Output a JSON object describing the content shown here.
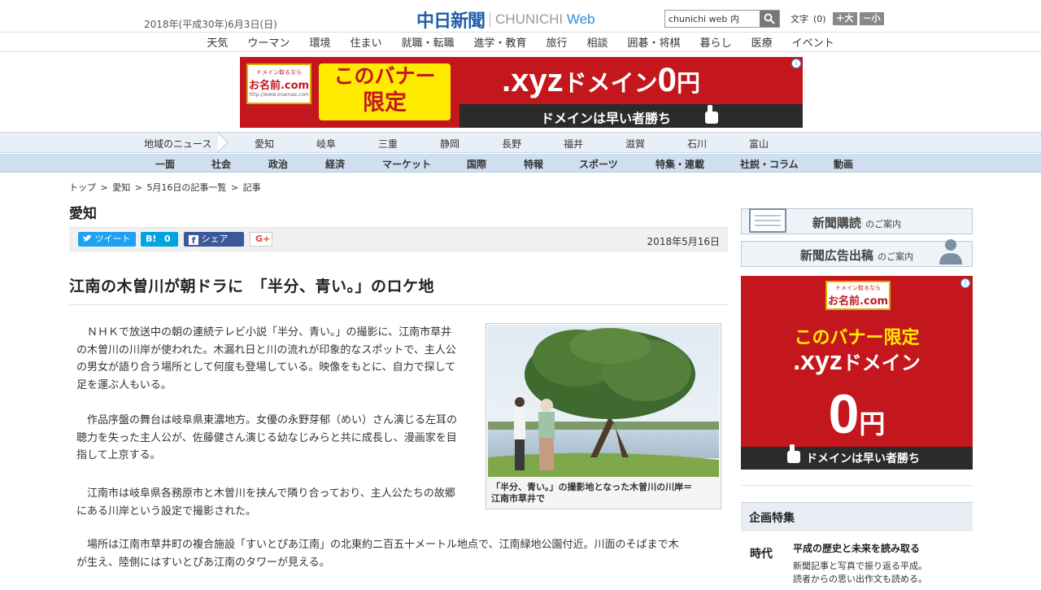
{
  "header": {
    "date": "2018年(平成30年)6月3日(日)",
    "logo_ja": "中日新聞",
    "logo_en_1": "CHUNICHI",
    "logo_en_2": "Web",
    "search_value": "chunichi web 内",
    "fontsize_label": "文字",
    "fontsize_value": "(0)",
    "font_up": "＋大",
    "font_down": "－小"
  },
  "categories": [
    "天気",
    "ウーマン",
    "環境",
    "住まい",
    "就職・転職",
    "進学・教育",
    "旅行",
    "相談",
    "囲碁・将棋",
    "暮らし",
    "医療",
    "イベント"
  ],
  "ad_top": {
    "brand_small": "ドメイン取るなら",
    "brand": "お名前.com",
    "url": "http://www.onamae.com",
    "line1": "このバナー",
    "line2": "限定",
    "big": ".xyz",
    "big2": "ドメイン",
    "zero": "0",
    "yen": "円",
    "sub": "ドメインは早い者勝ち"
  },
  "region_nav": {
    "label": "地域のニュース",
    "items": [
      "愛知",
      "岐阜",
      "三重",
      "静岡",
      "長野",
      "福井",
      "滋賀",
      "石川",
      "富山"
    ]
  },
  "section_nav": [
    "一面",
    "社会",
    "政治",
    "経済",
    "マーケット",
    "国際",
    "特報",
    "スポーツ",
    "特集・連載",
    "社説・コラム",
    "動画"
  ],
  "breadcrumb": [
    "トップ",
    ">",
    "愛知",
    ">",
    "5月16日の記事一覧",
    ">",
    "記事"
  ],
  "region_title": "愛知",
  "social": {
    "tweet": "ツイート",
    "hatena": "B!",
    "hatena_count": "0",
    "share": "シェア",
    "share_count": "30",
    "gplus": "G+"
  },
  "pub_date": "2018年5月16日",
  "article": {
    "title": "江南の木曽川が朝ドラに　「半分、青い。」のロケ地",
    "p1": [
      "ＮＨＫで放送中の朝の連続テレビ小説「半分、青い。」の撮影に、江南市草井",
      "の木曽川の川岸が使われた。木漏れ日と川の流れが印象的なスポットで、主人公",
      "の男女が語り合う場所として何度も登場している。映像をもとに、自力で探して",
      "足を運ぶ人もいる。"
    ],
    "p2": [
      "作品序盤の舞台は岐阜県東濃地方。女優の永野芽郁（めい）さん演じる左耳の",
      "聴力を失った主人公が、佐藤健さん演じる幼なじみらと共に成長し、漫画家を目",
      "指して上京する。"
    ],
    "p3": [
      "江南市は岐阜県各務原市と木曽川を挟んで隣り合っており、主人公たちの故郷",
      "にある川岸という設定で撮影された。"
    ],
    "p4": [
      "場所は江南市草井町の複合施設「すいとぴあ江南」の北東約二百五十メートル地点で、江南緑地公園付近。川面のそばまで木",
      "が生え、陸側にはすいとぴあ江南のタワーが見える。"
    ],
    "caption": [
      "「半分、青い。」の撮影地となった木曽川の川岸＝",
      "江南市草井で"
    ]
  },
  "side": {
    "btn1": "新聞購読",
    "btn1_small": "のご案内",
    "btn2": "新聞広告出稿",
    "btn2_small": "のご案内",
    "ad": {
      "brand_small": "ドメイン取るなら",
      "brand": "お名前.com",
      "line1": "このバナー限定",
      "big": ".xyz",
      "big2": "ドメイン",
      "zero": "0",
      "yen": "円",
      "sub": "ドメインは早い者勝ち"
    },
    "kikaku_title": "企画特集",
    "heisei_title": "平成の歴史と未来を読み取る",
    "heisei_desc1": "新聞記事と写真で振り返る平成。",
    "heisei_desc2": "読者からの思い出作文も読める。",
    "heisei_logo": "時代"
  },
  "colors": {
    "brand_blue": "#1f5fa8",
    "ad_red": "#c4171d",
    "twitter": "#1da1f2",
    "hatena": "#00a4de",
    "facebook": "#3b5998"
  }
}
